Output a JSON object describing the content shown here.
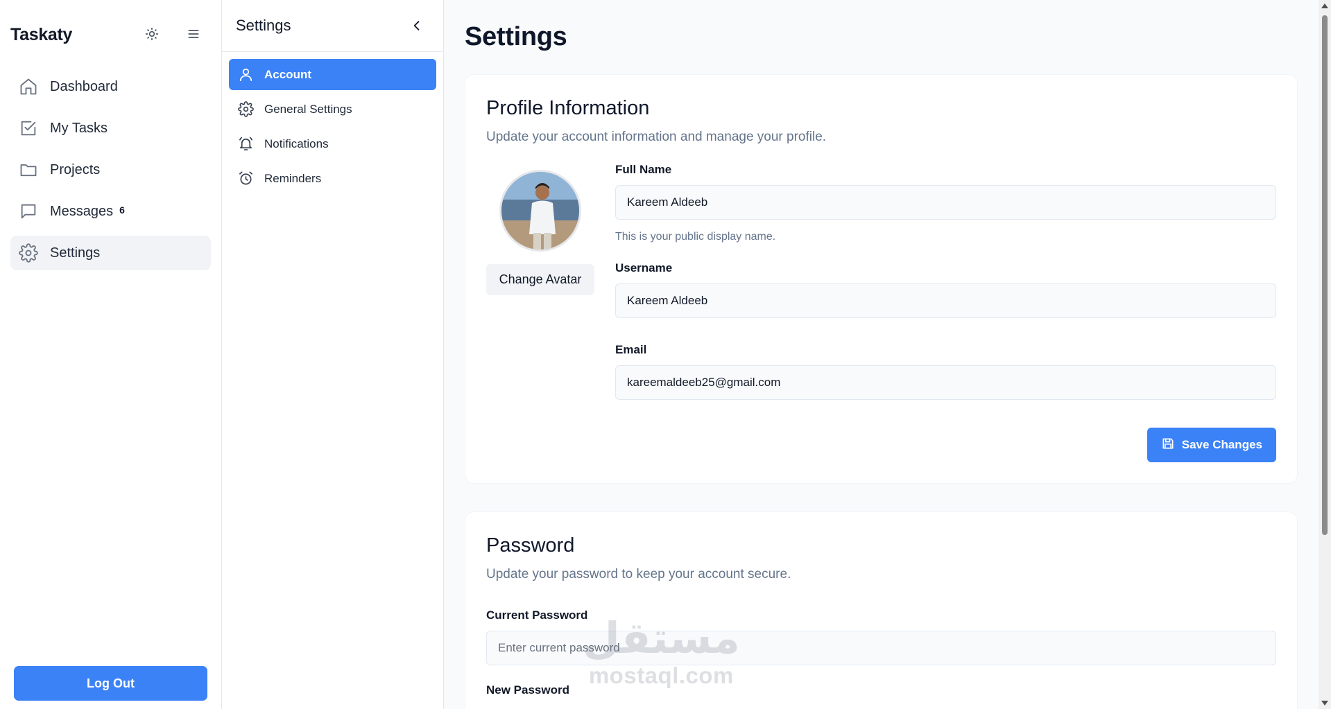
{
  "app": {
    "brand": "Taskaty"
  },
  "sidebar": {
    "items": [
      {
        "label": "Dashboard",
        "icon": "home-icon"
      },
      {
        "label": "My Tasks",
        "icon": "checkbox-icon"
      },
      {
        "label": "Projects",
        "icon": "folder-icon"
      },
      {
        "label": "Messages",
        "icon": "message-icon",
        "badge": "6"
      },
      {
        "label": "Settings",
        "icon": "gear-icon",
        "active": true
      }
    ],
    "logout_label": "Log Out"
  },
  "subnav": {
    "title": "Settings",
    "items": [
      {
        "label": "Account",
        "icon": "user-icon",
        "active": true
      },
      {
        "label": "General Settings",
        "icon": "gear-icon"
      },
      {
        "label": "Notifications",
        "icon": "bell-icon"
      },
      {
        "label": "Reminders",
        "icon": "alarm-clock-icon"
      }
    ]
  },
  "main": {
    "title": "Settings",
    "profile": {
      "title": "Profile Information",
      "subtitle": "Update your account information and manage your profile.",
      "change_avatar_label": "Change Avatar",
      "full_name_label": "Full Name",
      "full_name_value": "Kareem Aldeeb",
      "full_name_help": "This is your public display name.",
      "username_label": "Username",
      "username_value": "Kareem Aldeeb",
      "email_label": "Email",
      "email_value": "kareemaldeeb25@gmail.com",
      "save_label": "Save Changes"
    },
    "password": {
      "title": "Password",
      "subtitle": "Update your password to keep your account secure.",
      "current_label": "Current Password",
      "current_placeholder": "Enter current password",
      "new_label": "New Password"
    }
  },
  "watermark": {
    "arabic": "مستقل",
    "latin": "mostaql.com"
  },
  "colors": {
    "accent": "#3b82f6",
    "background": "#f8fafc",
    "muted_text": "#64748b"
  }
}
